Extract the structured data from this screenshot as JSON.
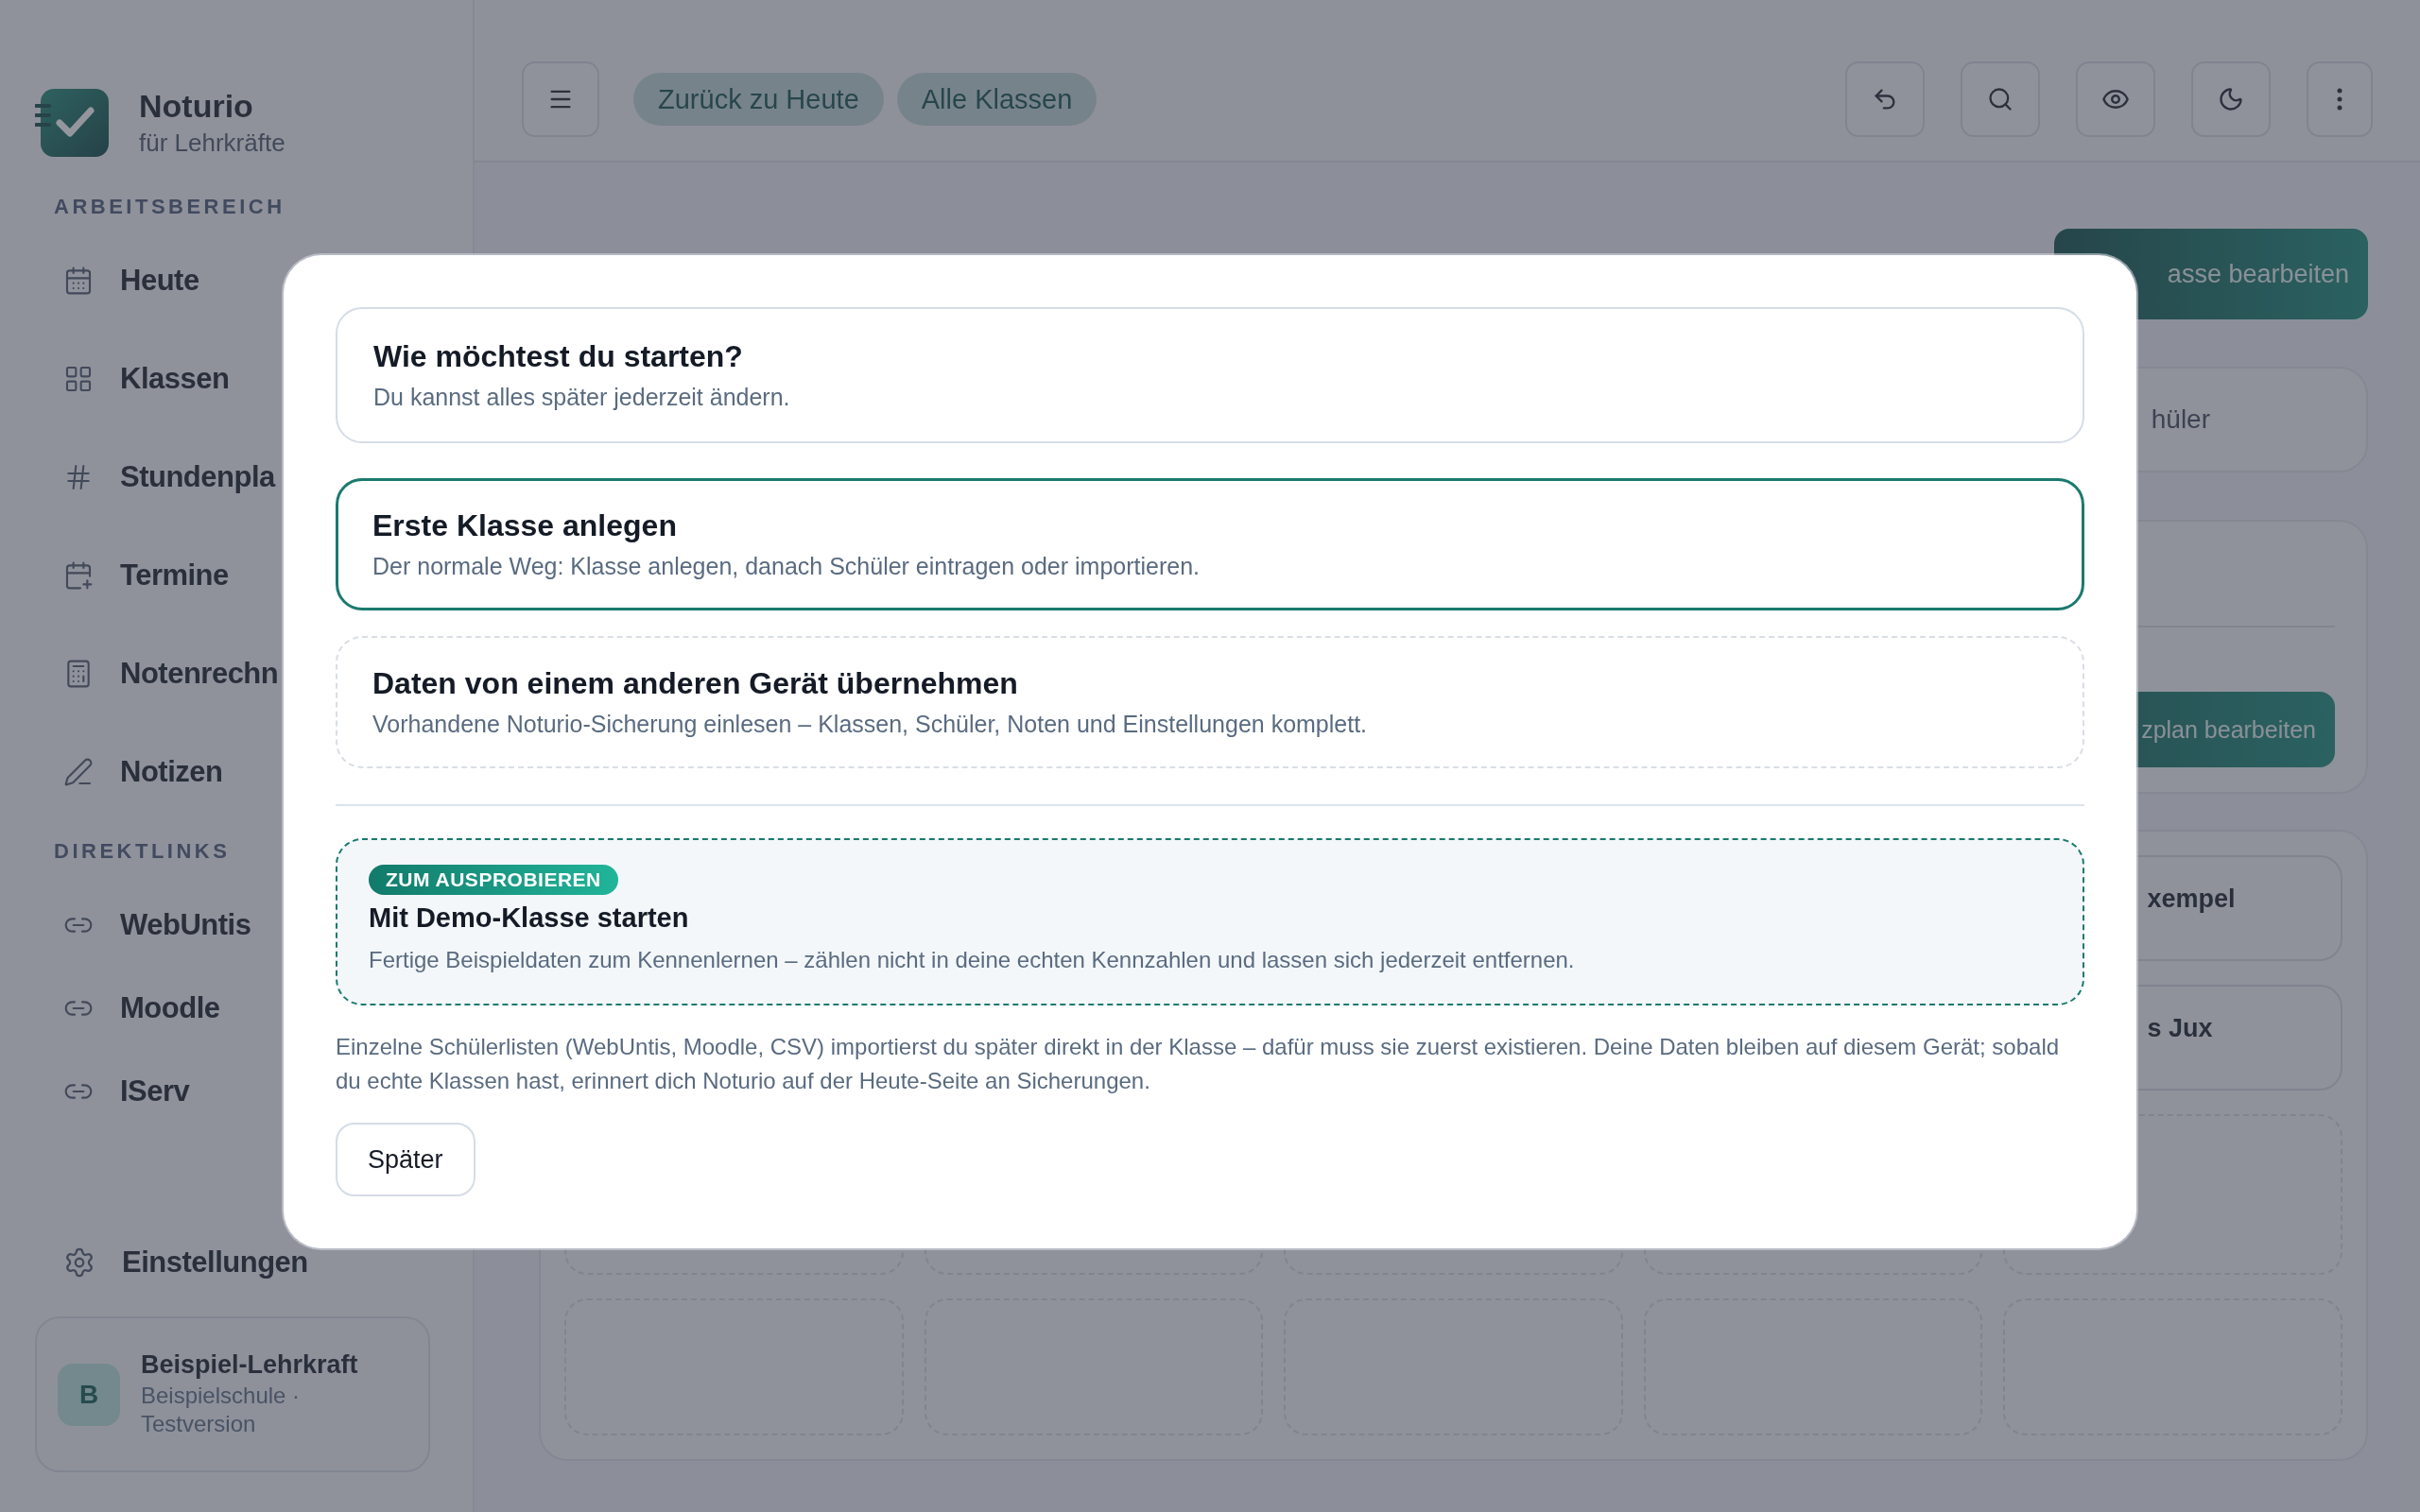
{
  "sidebar": {
    "brand": {
      "name": "Noturio",
      "tagline": "für Lehrkräfte"
    },
    "sections": [
      {
        "label": "ARBEITSBEREICH",
        "items": [
          {
            "label": "Heute"
          },
          {
            "label": "Klassen"
          },
          {
            "label": "Stundenpla"
          },
          {
            "label": "Termine"
          },
          {
            "label": "Notenrechn"
          },
          {
            "label": "Notizen"
          }
        ]
      },
      {
        "label": "DIREKTLINKS",
        "items": [
          {
            "label": "WebUntis"
          },
          {
            "label": "Moodle"
          },
          {
            "label": "IServ"
          }
        ]
      }
    ],
    "settings": {
      "label": "Einstellungen"
    },
    "profile": {
      "initial": "B",
      "name": "Beispiel-Lehrkraft",
      "details": "Beispielschule · Testversion"
    }
  },
  "topbar": {
    "chips": [
      "Zurück zu Heute",
      "Alle Klassen"
    ]
  },
  "background": {
    "edit_button": "asse bearbeiten",
    "students_card": "hüler",
    "seating_button": "zplan bearbeiten",
    "class_cards": [
      {
        "title": "xempel"
      },
      {
        "title": "s Jux"
      }
    ]
  },
  "dialog": {
    "header": {
      "title": "Wie möchtest du starten?",
      "subtitle": "Du kannst alles später jederzeit ändern."
    },
    "options": [
      {
        "title": "Erste Klasse anlegen",
        "description": "Der normale Weg: Klasse anlegen, danach Schüler eintragen oder importieren.",
        "selected": true
      },
      {
        "title": "Daten von einem anderen Gerät übernehmen",
        "description": "Vorhandene Noturio-Sicherung einlesen – Klassen, Schüler, Noten und Einstellungen komplett.",
        "selected": false
      }
    ],
    "demo": {
      "badge": "ZUM AUSPROBIEREN",
      "title": "Mit Demo-Klasse starten",
      "description": "Fertige Beispieldaten zum Kennenlernen – zählen nicht in deine echten Kennzahlen und lassen sich jederzeit entfernen."
    },
    "note": "Einzelne Schülerlisten (WebUntis, Moodle, CSV) importierst du später direkt in der Klasse – dafür muss sie zuerst existieren. Deine Daten bleiben auf diesem Gerät; sobald du echte Klassen hast, erinnert dich Noturio auf der Heute-Seite an Sicherungen.",
    "later_button": "Später"
  }
}
